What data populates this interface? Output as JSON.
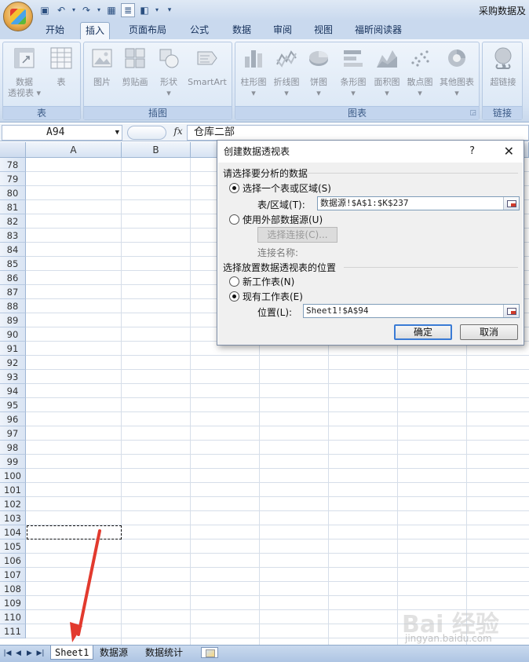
{
  "window": {
    "title": "采购数据及"
  },
  "ribbon": {
    "tabs": [
      "开始",
      "插入",
      "页面布局",
      "公式",
      "数据",
      "审阅",
      "视图",
      "福昕阅读器"
    ],
    "active_tab": "插入",
    "groups": [
      {
        "label": "表",
        "buttons": [
          "数据\n透视表",
          "表"
        ]
      },
      {
        "label": "插图",
        "buttons": [
          "图片",
          "剪贴画",
          "形状",
          "SmartArt"
        ]
      },
      {
        "label": "图表",
        "buttons": [
          "柱形图",
          "折线图",
          "饼图",
          "条形图",
          "面积图",
          "散点图",
          "其他图表"
        ]
      },
      {
        "label": "链接",
        "buttons": [
          "超链接"
        ]
      }
    ]
  },
  "formula_bar": {
    "name_box": "A94",
    "fx": "fx",
    "content": "仓库二部"
  },
  "grid": {
    "columns": [
      "A",
      "B"
    ],
    "rows": [
      "78",
      "79",
      "80",
      "81",
      "82",
      "83",
      "84",
      "85",
      "86",
      "87",
      "88",
      "89",
      "90",
      "91",
      "92",
      "93",
      "94",
      "95",
      "96",
      "97",
      "98",
      "99",
      "100",
      "101",
      "102",
      "103",
      "104",
      "105",
      "106",
      "107",
      "108",
      "109",
      "110",
      "111"
    ]
  },
  "dialog": {
    "title": "创建数据透视表",
    "help": "?",
    "close": "✕",
    "section1": "请选择要分析的数据",
    "opt_range": "选择一个表或区域(S)",
    "range_label": "表/区域(T):",
    "range_value": "数据源!$A$1:$K$237",
    "opt_external": "使用外部数据源(U)",
    "choose_conn": "选择连接(C)...",
    "conn_name": "连接名称:",
    "section2": "选择放置数据透视表的位置",
    "opt_new": "新工作表(N)",
    "opt_existing": "现有工作表(E)",
    "loc_label": "位置(L):",
    "loc_value": "Sheet1!$A$94",
    "ok": "确定",
    "cancel": "取消"
  },
  "sheet_tabs": {
    "tabs": [
      "Sheet1",
      "数据源",
      "数据统计"
    ],
    "active": "Sheet1"
  },
  "watermark": {
    "logo": "Bai 经验",
    "url": "jingyan.baidu.com"
  },
  "colors": {
    "accent": "#3a7bd5",
    "ribbon": "#d6e3f3",
    "arrow": "#e23a2e"
  }
}
